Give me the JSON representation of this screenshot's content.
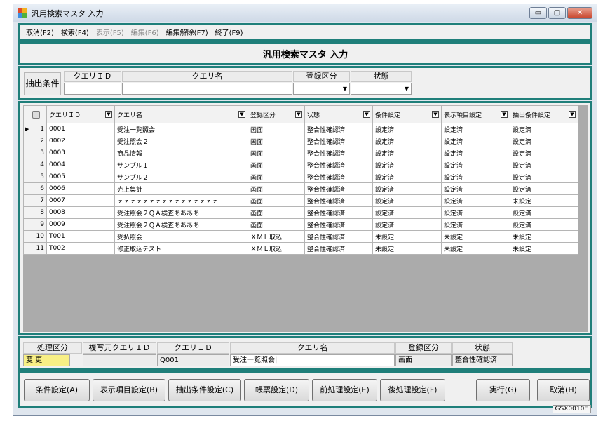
{
  "window": {
    "title": "汎用検索マスタ 入力",
    "controls": [
      "▭",
      "▢",
      "✕"
    ],
    "icon_colors": [
      "#e04a2a",
      "#f2b01e",
      "#3c8ee0",
      "#52b03a"
    ]
  },
  "menu": [
    {
      "label": "取消(F2)",
      "enabled": true
    },
    {
      "label": "検索(F4)",
      "enabled": true
    },
    {
      "label": "表示(F5)",
      "enabled": false
    },
    {
      "label": "編集(F6)",
      "enabled": false
    },
    {
      "label": "編集解除(F7)",
      "enabled": true
    },
    {
      "label": "終了(F9)",
      "enabled": true
    }
  ],
  "screen_title": "汎用検索マスタ 入力",
  "filter": {
    "label": "抽出条件",
    "headers": [
      "クエリＩＤ",
      "クエリ名",
      "登録区分",
      "状態"
    ],
    "values": [
      "",
      "",
      "",
      ""
    ]
  },
  "grid": {
    "columns": [
      "クエリＩＤ",
      "クエリ名",
      "登録区分",
      "状態",
      "条件設定",
      "表示項目設定",
      "抽出条件設定"
    ],
    "rows": [
      [
        "1",
        "0001",
        "受注一覧照会",
        "画面",
        "整合性確認済",
        "設定済",
        "設定済",
        "設定済"
      ],
      [
        "2",
        "0002",
        "受注照会２",
        "画面",
        "整合性確認済",
        "設定済",
        "設定済",
        "設定済"
      ],
      [
        "3",
        "0003",
        "商品情報",
        "画面",
        "整合性確認済",
        "設定済",
        "設定済",
        "設定済"
      ],
      [
        "4",
        "0004",
        "サンプル１",
        "画面",
        "整合性確認済",
        "設定済",
        "設定済",
        "設定済"
      ],
      [
        "5",
        "0005",
        "サンプル２",
        "画面",
        "整合性確認済",
        "設定済",
        "設定済",
        "設定済"
      ],
      [
        "6",
        "0006",
        "売上集計",
        "画面",
        "整合性確認済",
        "設定済",
        "設定済",
        "設定済"
      ],
      [
        "7",
        "0007",
        "ｚｚｚｚｚｚｚｚｚｚｚｚｚｚｚｚ",
        "画面",
        "整合性確認済",
        "設定済",
        "設定済",
        "未設定"
      ],
      [
        "8",
        "0008",
        "受注照会２ＱＡ検査ああああ",
        "画面",
        "整合性確認済",
        "設定済",
        "設定済",
        "設定済"
      ],
      [
        "9",
        "0009",
        "受注照会２ＱＡ検査ああああ",
        "画面",
        "整合性確認済",
        "設定済",
        "設定済",
        "設定済"
      ],
      [
        "10",
        "T001",
        "受払照会",
        "ＸＭＬ取込",
        "整合性確認済",
        "未設定",
        "未設定",
        "未設定"
      ],
      [
        "11",
        "T002",
        "修正取込テスト",
        "ＸＭＬ取込",
        "整合性確認済",
        "未設定",
        "未設定",
        "未設定"
      ]
    ],
    "current_row_marker": "▶"
  },
  "detail": {
    "headers": [
      "処理区分",
      "複写元クエリＩＤ",
      "クエリＩＤ",
      "クエリ名",
      "登録区分",
      "状態"
    ],
    "values": [
      "変 更",
      "",
      "Q001",
      "受注一覧照会",
      "画面",
      "整合性確認済"
    ]
  },
  "buttons": [
    "条件設定(A)",
    "表示項目設定(B)",
    "抽出条件設定(C)",
    "帳票設定(D)",
    "前処理設定(E)",
    "後処理設定(F)",
    "実行(G)",
    "取消(H)"
  ],
  "status": {
    "screen_code": "GSX0010E"
  },
  "colors": {
    "frame": "#1f7f7a",
    "processing_type_bg": "#f8ef85",
    "grid_background": "#ababab"
  }
}
